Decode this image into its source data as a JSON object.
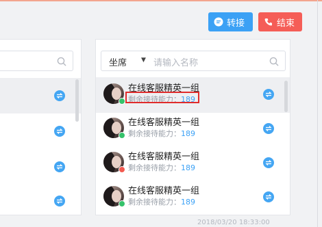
{
  "header": {
    "transfer_label": "转接",
    "end_label": "结束"
  },
  "right_panel": {
    "select_value": "坐席",
    "search_placeholder": "请输入名称",
    "agents": [
      {
        "name": "在线客服精英一组",
        "capacity_label": "剩余接待能力：",
        "capacity_value": "189",
        "status": "online"
      },
      {
        "name": "在线客服精英一组",
        "capacity_label": "剩余接待能力：",
        "capacity_value": "189",
        "status": "online"
      },
      {
        "name": "在线客服精英一组",
        "capacity_label": "剩余接待能力：",
        "capacity_value": "189",
        "status": "busy"
      },
      {
        "name": "在线客服精英一组",
        "capacity_label": "剩余接待能力：",
        "capacity_value": "189",
        "status": "online"
      }
    ]
  },
  "footer": {
    "timestamp": "2018/03/20 18:33:00"
  },
  "colors": {
    "accent": "#3ba1f5",
    "danger": "#f55d57",
    "online": "#35c26b",
    "busy": "#f25a50"
  }
}
